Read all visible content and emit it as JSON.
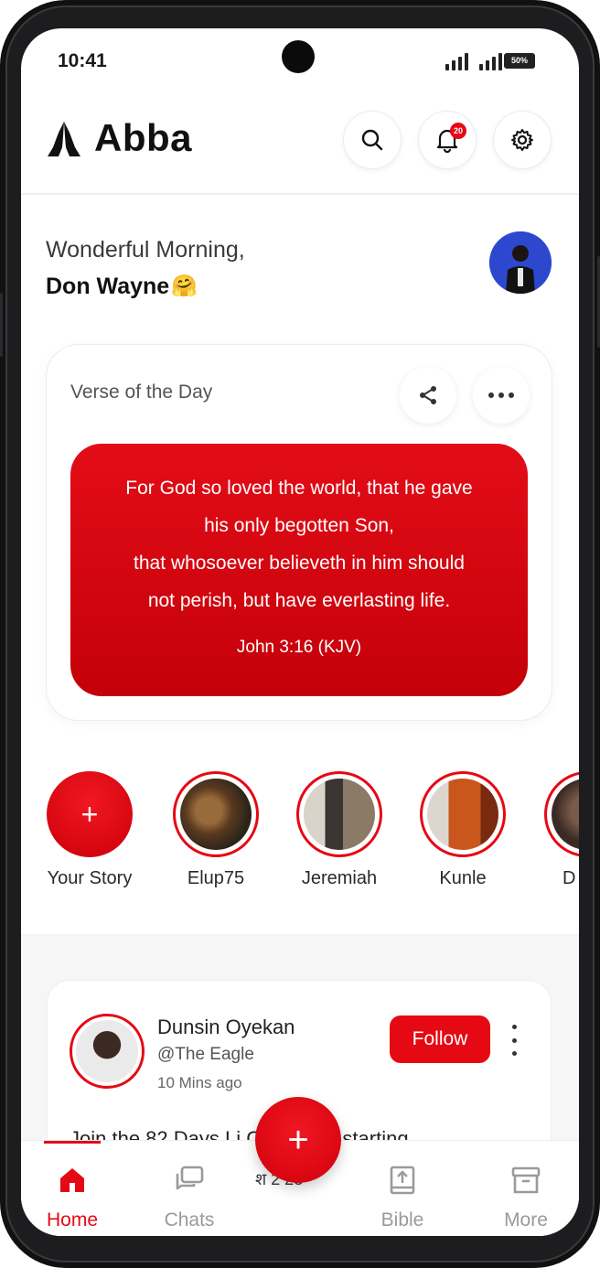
{
  "status_bar": {
    "time": "10:41",
    "battery": "50%"
  },
  "header": {
    "app_name": "Abba",
    "notification_count": "20",
    "icons": [
      "search-icon",
      "bell-icon",
      "gear-icon"
    ]
  },
  "greeting": {
    "line1": "Wonderful Morning,",
    "name": "Don Wayne",
    "emoji": "🤗"
  },
  "verse_card": {
    "title": "Verse of the Day",
    "lines": [
      "For God so loved the world, that he gave",
      "his only begotten Son,",
      "that whosoever believeth in him should",
      "not perish, but have everlasting life."
    ],
    "reference": "John 3:16 (KJV)"
  },
  "stories": {
    "add_label": "Your Story",
    "add_symbol": "+",
    "items": [
      {
        "label": "Elup75"
      },
      {
        "label": "Jeremiah"
      },
      {
        "label": "Kunle"
      },
      {
        "label": "D"
      }
    ]
  },
  "post": {
    "author": "Dunsin Oyekan",
    "handle": "@The Eagle",
    "time": "10 Mins ago",
    "follow_label": "Follow",
    "text": "Join the 82 Days Li Challenge starting"
  },
  "fab": {
    "symbol": "+"
  },
  "bottom_nav": {
    "items": [
      {
        "label": "Home",
        "icon": "home-icon",
        "active": true
      },
      {
        "label": "Chats",
        "icon": "chat-icon",
        "active": false
      },
      {
        "label": "Bible",
        "icon": "bible-icon",
        "active": false
      },
      {
        "label": "More",
        "icon": "archive-icon",
        "active": false
      }
    ],
    "peek_text": "श 2 23 ·"
  },
  "colors": {
    "accent": "#e50914",
    "accent_dark": "#c40009",
    "text": "#111111",
    "muted": "#9a9a9a"
  }
}
